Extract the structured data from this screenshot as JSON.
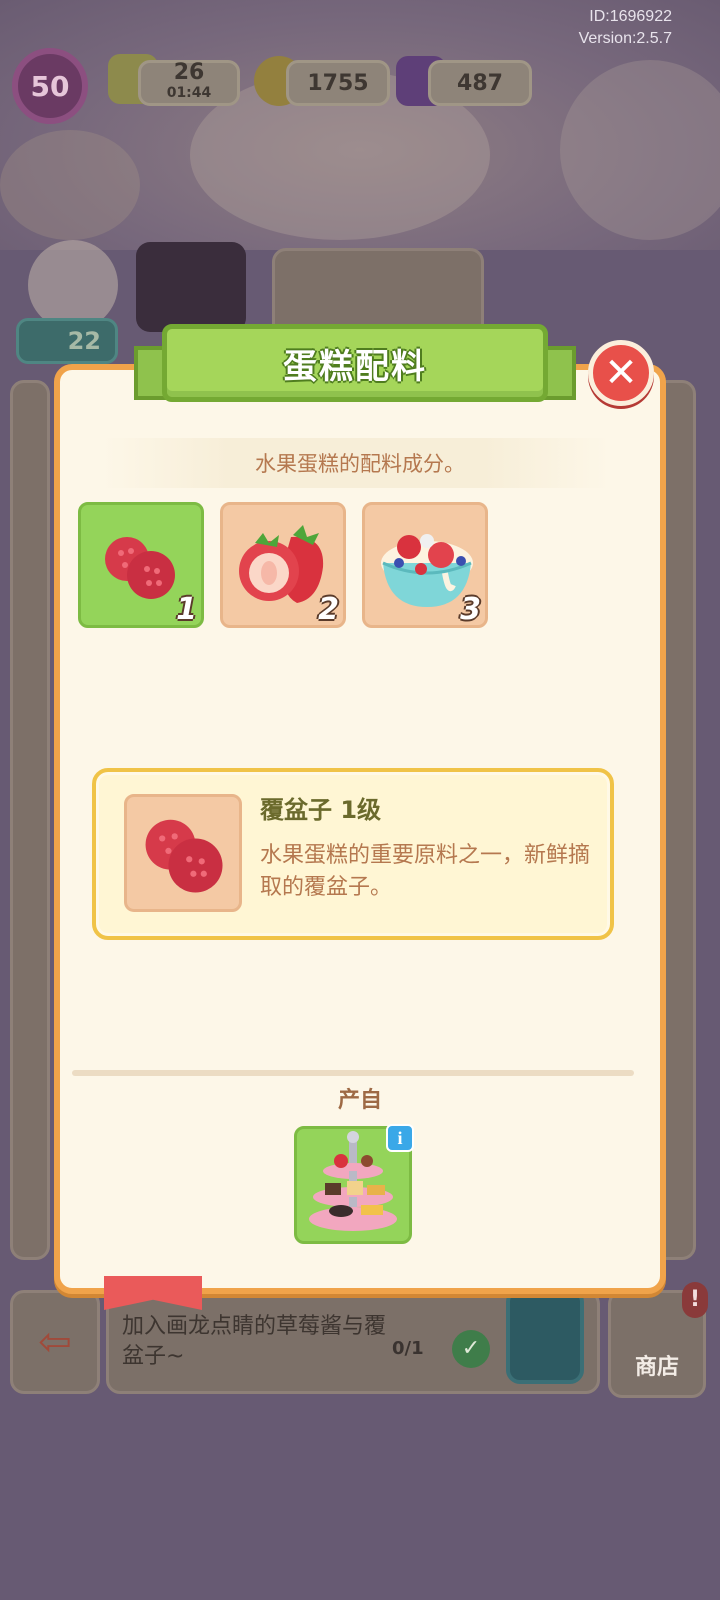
{
  "hud": {
    "build_id": "ID:1696922",
    "version": "Version:2.5.7",
    "level": "50",
    "energy": "26",
    "energy_timer": "01:44",
    "coins": "1755",
    "gems": "487",
    "stars": "22"
  },
  "dialog": {
    "title": "蛋糕配料",
    "subtitle": "水果蛋糕的配料成分。",
    "close_icon": "close-x-icon",
    "ingredients": [
      {
        "num": "1",
        "icon": "raspberry-icon",
        "selected": true
      },
      {
        "num": "2",
        "icon": "strawberry-icon",
        "selected": false
      },
      {
        "num": "3",
        "icon": "fruit-bowl-icon",
        "selected": false
      }
    ],
    "detail": {
      "name": "覆盆子  1级",
      "description": "水果蛋糕的重要原料之一，新鲜摘取的覆盆子。"
    },
    "source": {
      "label": "产自",
      "producer_icon": "dessert-stand-icon",
      "info_icon": "info-icon"
    }
  },
  "background": {
    "quest_text": "加入画龙点睛的草莓酱与覆盆子~",
    "quest_progress": "0/1",
    "shop_label": "商店",
    "shop_alert": "!"
  },
  "colors": {
    "panel_border": "#f0a34a",
    "title_green": "#a5d65a",
    "close_red": "#e8504a",
    "text_brown": "#b5784f",
    "selected_tile": "#94d45a",
    "tile_peach": "#f4c9a4"
  }
}
